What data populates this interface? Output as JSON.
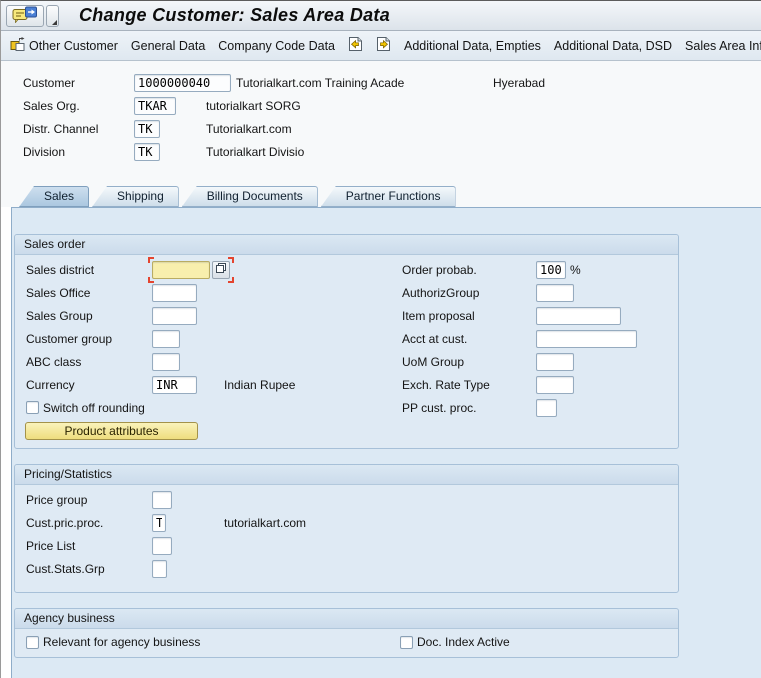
{
  "titlebar": {
    "title": "Change Customer: Sales Area Data"
  },
  "toolbar": {
    "other_customer": "Other Customer",
    "general_data": "General Data",
    "company_code_data": "Company Code Data",
    "additional_data_empties": "Additional Data, Empties",
    "additional_data_dsd": "Additional Data, DSD",
    "sales_area_information": "Sales Area Informa"
  },
  "header_fields": {
    "customer": {
      "label": "Customer",
      "value": "1000000040",
      "description": "Tutorialkart.com Training Acade",
      "city": "Hyerabad"
    },
    "sales_org": {
      "label": "Sales Org.",
      "value": "TKAR",
      "description": "tutorialkart SORG"
    },
    "distr_channel": {
      "label": "Distr. Channel",
      "value": "TK",
      "description": "Tutorialkart.com"
    },
    "division": {
      "label": "Division",
      "value": "TK",
      "description": "Tutorialkart Divisio"
    }
  },
  "tabs": {
    "sales": "Sales",
    "shipping": "Shipping",
    "billing_documents": "Billing Documents",
    "partner_functions": "Partner Functions"
  },
  "sales_order": {
    "title": "Sales order",
    "sales_district": {
      "label": "Sales district",
      "value": ""
    },
    "sales_office": {
      "label": "Sales Office",
      "value": ""
    },
    "sales_group": {
      "label": "Sales Group",
      "value": ""
    },
    "customer_group": {
      "label": "Customer group",
      "value": ""
    },
    "abc_class": {
      "label": "ABC class",
      "value": ""
    },
    "currency": {
      "label": "Currency",
      "value": "INR",
      "description": "Indian Rupee"
    },
    "switch_off_rounding": {
      "label": "Switch off rounding",
      "checked": false
    },
    "product_attributes_button": "Product attributes",
    "order_probab": {
      "label": "Order probab.",
      "value": "100",
      "unit": "%"
    },
    "authoriz_group": {
      "label": "AuthorizGroup",
      "value": ""
    },
    "item_proposal": {
      "label": "Item proposal",
      "value": ""
    },
    "acct_at_cust": {
      "label": "Acct at cust.",
      "value": ""
    },
    "uom_group": {
      "label": "UoM Group",
      "value": ""
    },
    "exch_rate_type": {
      "label": "Exch. Rate Type",
      "value": ""
    },
    "pp_cust_proc": {
      "label": "PP cust. proc.",
      "value": ""
    }
  },
  "pricing_statistics": {
    "title": "Pricing/Statistics",
    "price_group": {
      "label": "Price group",
      "value": ""
    },
    "cust_pric_proc": {
      "label": "Cust.pric.proc.",
      "value": "T",
      "description": "tutorialkart.com"
    },
    "price_list": {
      "label": "Price List",
      "value": ""
    },
    "cust_stats_grp": {
      "label": "Cust.Stats.Grp",
      "value": ""
    }
  },
  "agency_business": {
    "title": "Agency business",
    "relevant_for_agency": {
      "label": "Relevant for agency business",
      "checked": false
    },
    "doc_index_active": {
      "label": "Doc. Index Active",
      "checked": false
    }
  },
  "icons": {
    "titlebar_menu": "services-for-object-icon",
    "titlebar_dropdown": "dropdown-arrow-icon",
    "other_customer": "other-customer-icon",
    "previous_screen": "previous-screen-icon",
    "next_screen": "next-screen-icon",
    "sales_district_help": "matchcode-icon"
  },
  "colors": {
    "panel_background": "#dce9f4",
    "group_box_border": "#a7c0d8",
    "active_tab": "#aac6df",
    "highlighted_field": "#f8efad",
    "focus_marker": "#e4452f",
    "action_button_yellow": "#eedd7e"
  }
}
